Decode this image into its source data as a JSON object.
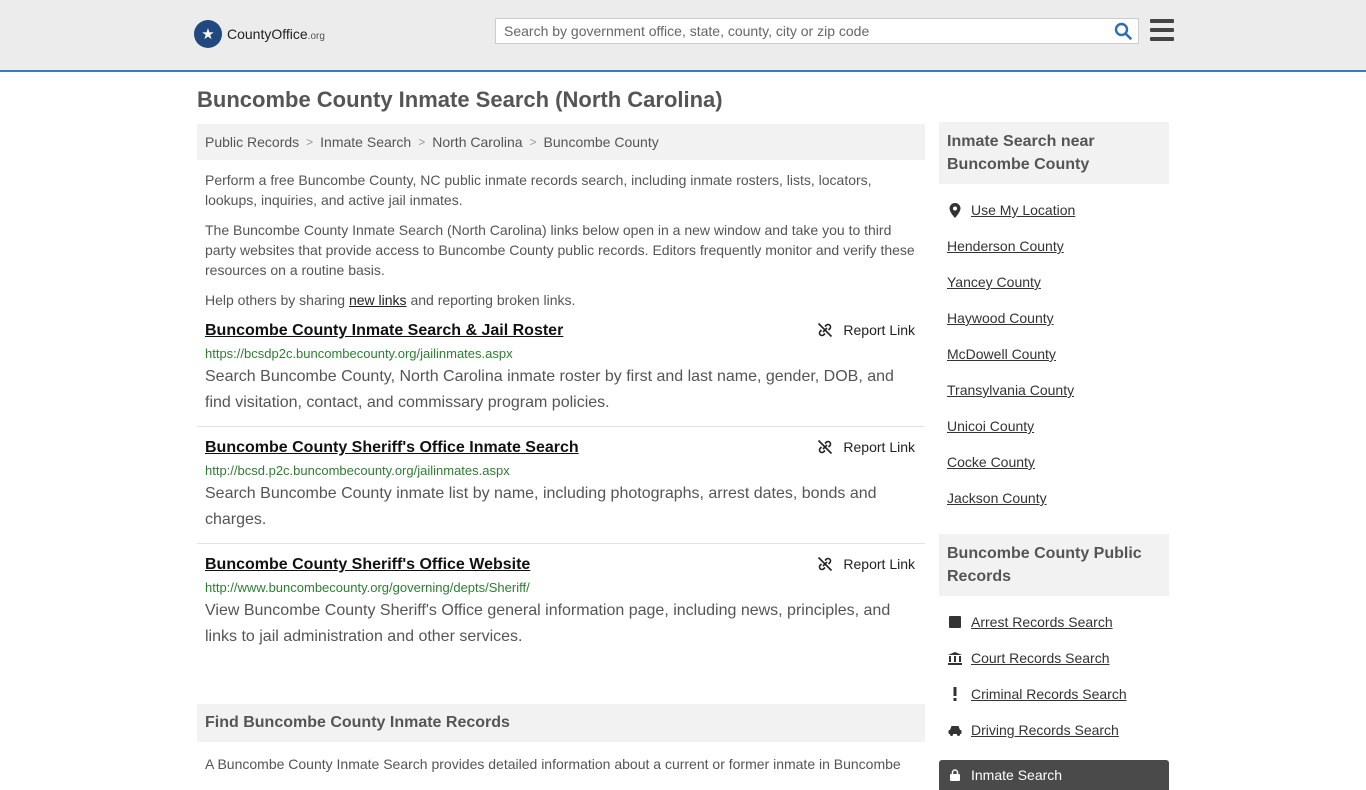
{
  "header": {
    "logo_brand": "CountyOffice",
    "logo_tld": ".org",
    "search_placeholder": "Search by government office, state, county, city or zip code"
  },
  "page": {
    "title": "Buncombe County Inmate Search (North Carolina)",
    "breadcrumb": [
      "Public Records",
      "Inmate Search",
      "North Carolina",
      "Buncombe County"
    ],
    "intro1": "Perform a free Buncombe County, NC public inmate records search, including inmate rosters, lists, locators, lookups, inquiries, and active jail inmates.",
    "intro2": "The Buncombe County Inmate Search (North Carolina) links below open in a new window and take you to third party websites that provide access to Buncombe County public records. Editors frequently monitor and verify these resources on a routine basis.",
    "help_prefix": "Help others by sharing ",
    "help_link": "new links",
    "help_suffix": " and reporting broken links.",
    "report_label": "Report Link",
    "results": [
      {
        "title": "Buncombe County Inmate Search & Jail Roster",
        "url": "https://bcsdp2c.buncombecounty.org/jailinmates.aspx",
        "desc": "Search Buncombe County, North Carolina inmate roster by first and last name, gender, DOB, and find visitation, contact, and commissary program policies."
      },
      {
        "title": "Buncombe County Sheriff's Office Inmate Search",
        "url": "http://bcsd.p2c.buncombecounty.org/jailinmates.aspx",
        "desc": "Search Buncombe County inmate list by name, including photographs, arrest dates, bonds and charges."
      },
      {
        "title": "Buncombe County Sheriff's Office Website",
        "url": "http://www.buncombecounty.org/governing/depts/Sheriff/",
        "desc": "View Buncombe County Sheriff's Office general information page, including news, principles, and links to jail administration and other services."
      }
    ],
    "find_heading": "Find Buncombe County Inmate Records",
    "find_text": "A Buncombe County Inmate Search provides detailed information about a current or former inmate in Buncombe"
  },
  "sidebar": {
    "near_heading": "Inmate Search near Buncombe County",
    "use_location": "Use My Location",
    "near": [
      "Henderson County",
      "Yancey County",
      "Haywood County",
      "McDowell County",
      "Transylvania County",
      "Unicoi County",
      "Cocke County",
      "Jackson County"
    ],
    "records_heading": "Buncombe County Public Records",
    "records": [
      {
        "label": "Arrest Records Search",
        "icon": "square-icon"
      },
      {
        "label": "Court Records Search",
        "icon": "courthouse-icon"
      },
      {
        "label": "Criminal Records Search",
        "icon": "exclamation-icon"
      },
      {
        "label": "Driving Records Search",
        "icon": "car-icon"
      }
    ],
    "active_item": "Inmate Search"
  }
}
